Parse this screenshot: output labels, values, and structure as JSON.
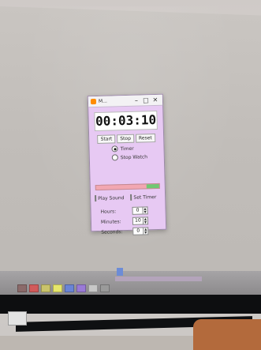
{
  "window": {
    "title": "M...",
    "min_symbol": "–",
    "max_symbol": "□",
    "close_symbol": "✕",
    "icon": "app-icon"
  },
  "timer": {
    "display": "00:03:10",
    "progress_fraction": 0.2
  },
  "buttons": {
    "start": "Start",
    "stop": "Stop",
    "reset": "Reset"
  },
  "mode": {
    "options": [
      {
        "label": "Timer",
        "selected": true
      },
      {
        "label": "Stop Watch",
        "selected": false
      }
    ]
  },
  "options": {
    "play_sound": "Play Sound",
    "set_timer": "Set Timer"
  },
  "fields": {
    "hours": {
      "label": "Hours:",
      "value": "0"
    },
    "minutes": {
      "label": "Minutes:",
      "value": "10"
    },
    "seconds": {
      "label": "Seconds:",
      "value": "0"
    }
  },
  "colors": {
    "window_bg": "#e7c9f3",
    "progress_remaining": "#f2a7b1",
    "progress_fill": "#70c873"
  }
}
